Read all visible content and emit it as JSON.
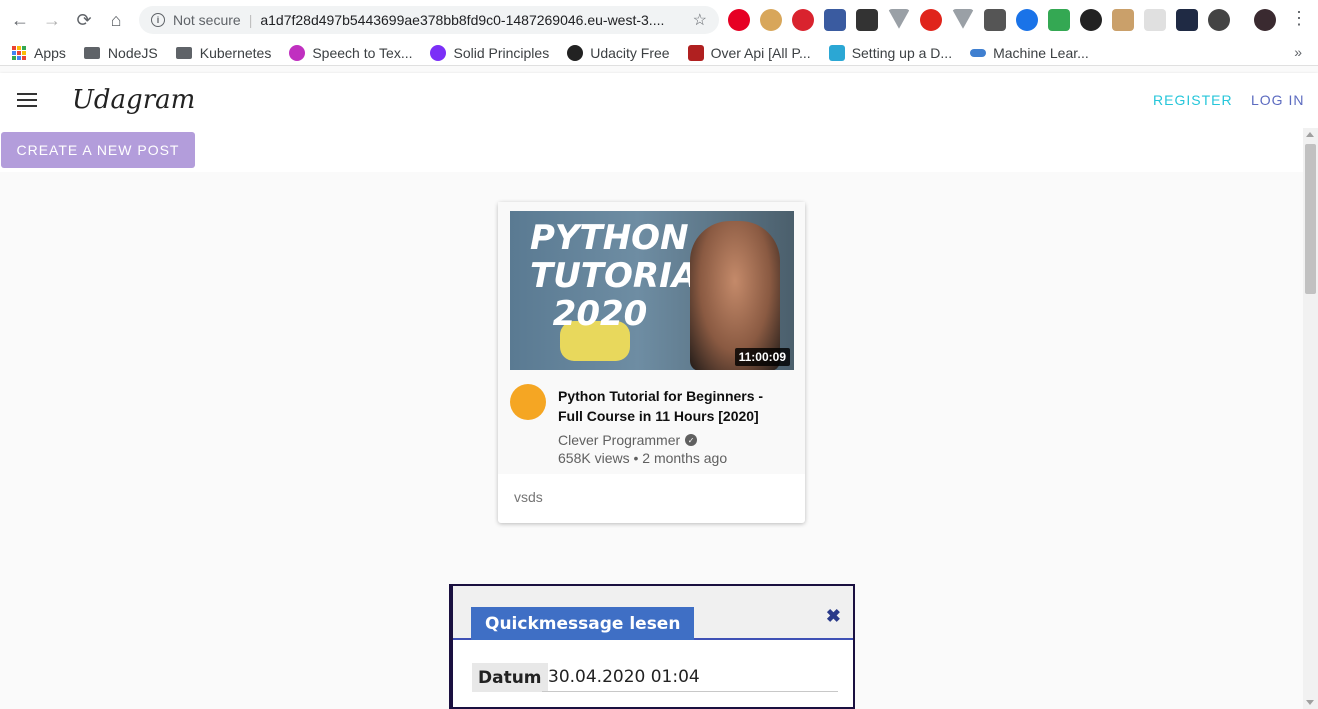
{
  "browser": {
    "security_label": "Not secure",
    "url": "a1d7f28d497b5443699ae378bb8fd9c0-1487269046.eu-west-3....",
    "bookmarks": [
      {
        "label": "Apps",
        "icon": "apps-grid-icon"
      },
      {
        "label": "NodeJS",
        "icon": "folder-icon"
      },
      {
        "label": "Kubernetes",
        "icon": "folder-icon"
      },
      {
        "label": "Speech to Tex...",
        "icon": "speech-icon"
      },
      {
        "label": "Solid Principles",
        "icon": "heart-icon"
      },
      {
        "label": "Udacity Free",
        "icon": "github-icon"
      },
      {
        "label": "Over Api [All P...",
        "icon": "api-icon"
      },
      {
        "label": "Setting up a D...",
        "icon": "bookmark-icon"
      },
      {
        "label": "Machine Lear...",
        "icon": "infinity-icon"
      }
    ],
    "bookmarks_overflow": "»"
  },
  "header": {
    "brand": "Udagram",
    "register_label": "REGISTER",
    "login_label": "LOG IN"
  },
  "main": {
    "create_button_label": "CREATE A NEW POST"
  },
  "post": {
    "thumbnail_text": "PYTHON TUTORIAL 2020",
    "duration": "11:00:09",
    "video_title": "Python Tutorial for Beginners - Full Course in 11 Hours [2020]",
    "channel_name": "Clever Programmer",
    "stats": "658K views • 2 months ago",
    "caption": "vsds"
  },
  "quickmessage": {
    "title": "Quickmessage lesen",
    "close_symbol": "✖",
    "date_label": "Datum",
    "date_value": "30.04.2020 01:04"
  },
  "colors": {
    "register": "#26c6da",
    "login": "#5c6bc0",
    "create_button": "#b39ddb",
    "qm_tab": "#3f6fc5"
  }
}
